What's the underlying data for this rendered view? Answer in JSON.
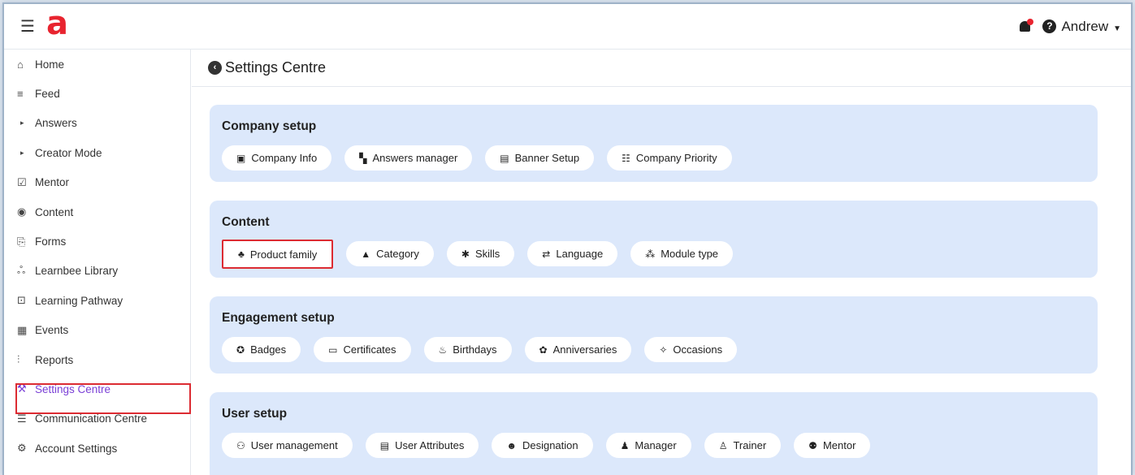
{
  "header": {
    "logo": "a",
    "user_name": "Andrew"
  },
  "sidebar": {
    "items": [
      {
        "label": "Home",
        "icon": "home-icon",
        "glyph": "⌂"
      },
      {
        "label": "Feed",
        "icon": "feed-icon",
        "glyph": "≡"
      },
      {
        "label": "Answers",
        "icon": "caret-right-icon",
        "glyph": "▸"
      },
      {
        "label": "Creator Mode",
        "icon": "caret-right-icon",
        "glyph": "▸"
      },
      {
        "label": "Mentor",
        "icon": "checkbox-icon",
        "glyph": "☑"
      },
      {
        "label": "Content",
        "icon": "content-icon",
        "glyph": "◉"
      },
      {
        "label": "Forms",
        "icon": "forms-icon",
        "glyph": "⎘"
      },
      {
        "label": "Learnbee Library",
        "icon": "library-icon",
        "glyph": "ஃ"
      },
      {
        "label": "Learning Pathway",
        "icon": "pathway-icon",
        "glyph": "⊡"
      },
      {
        "label": "Events",
        "icon": "calendar-icon",
        "glyph": "▦"
      },
      {
        "label": "Reports",
        "icon": "reports-icon",
        "glyph": "⫶"
      },
      {
        "label": "Settings Centre",
        "icon": "gavel-icon",
        "glyph": "⚒"
      },
      {
        "label": "Communication Centre",
        "icon": "communication-icon",
        "glyph": "☰"
      },
      {
        "label": "Account Settings",
        "icon": "account-settings-icon",
        "glyph": "⚙"
      }
    ]
  },
  "main": {
    "title": "Settings Centre",
    "sections": [
      {
        "title": "Company setup",
        "pills": [
          {
            "label": "Company Info",
            "icon": "monitor-icon",
            "glyph": "▣"
          },
          {
            "label": "Answers manager",
            "icon": "grid-plus-icon",
            "glyph": "▚"
          },
          {
            "label": "Banner Setup",
            "icon": "banner-icon",
            "glyph": "▤"
          },
          {
            "label": "Company Priority",
            "icon": "priority-icon",
            "glyph": "☷"
          }
        ]
      },
      {
        "title": "Content",
        "pills": [
          {
            "label": "Product family",
            "icon": "product-family-icon",
            "glyph": "♣"
          },
          {
            "label": "Category",
            "icon": "category-icon",
            "glyph": "▲"
          },
          {
            "label": "Skills",
            "icon": "skills-icon",
            "glyph": "✱"
          },
          {
            "label": "Language",
            "icon": "language-icon",
            "glyph": "⇄"
          },
          {
            "label": "Module type",
            "icon": "module-type-icon",
            "glyph": "⁂"
          }
        ]
      },
      {
        "title": "Engagement setup",
        "pills": [
          {
            "label": "Badges",
            "icon": "badge-icon",
            "glyph": "✪"
          },
          {
            "label": "Certificates",
            "icon": "certificate-icon",
            "glyph": "▭"
          },
          {
            "label": "Birthdays",
            "icon": "cake-icon",
            "glyph": "♨"
          },
          {
            "label": "Anniversaries",
            "icon": "gift-icon",
            "glyph": "✿"
          },
          {
            "label": "Occasions",
            "icon": "party-icon",
            "glyph": "✧"
          }
        ]
      },
      {
        "title": "User setup",
        "pills": [
          {
            "label": "User management",
            "icon": "users-icon",
            "glyph": "⚇"
          },
          {
            "label": "User Attributes",
            "icon": "attributes-icon",
            "glyph": "▤"
          },
          {
            "label": "Designation",
            "icon": "designation-icon",
            "glyph": "☻"
          },
          {
            "label": "Manager",
            "icon": "manager-icon",
            "glyph": "♟"
          },
          {
            "label": "Trainer",
            "icon": "trainer-icon",
            "glyph": "♙"
          },
          {
            "label": "Mentor",
            "icon": "mentor-icon",
            "glyph": "⚉"
          }
        ]
      }
    ]
  }
}
